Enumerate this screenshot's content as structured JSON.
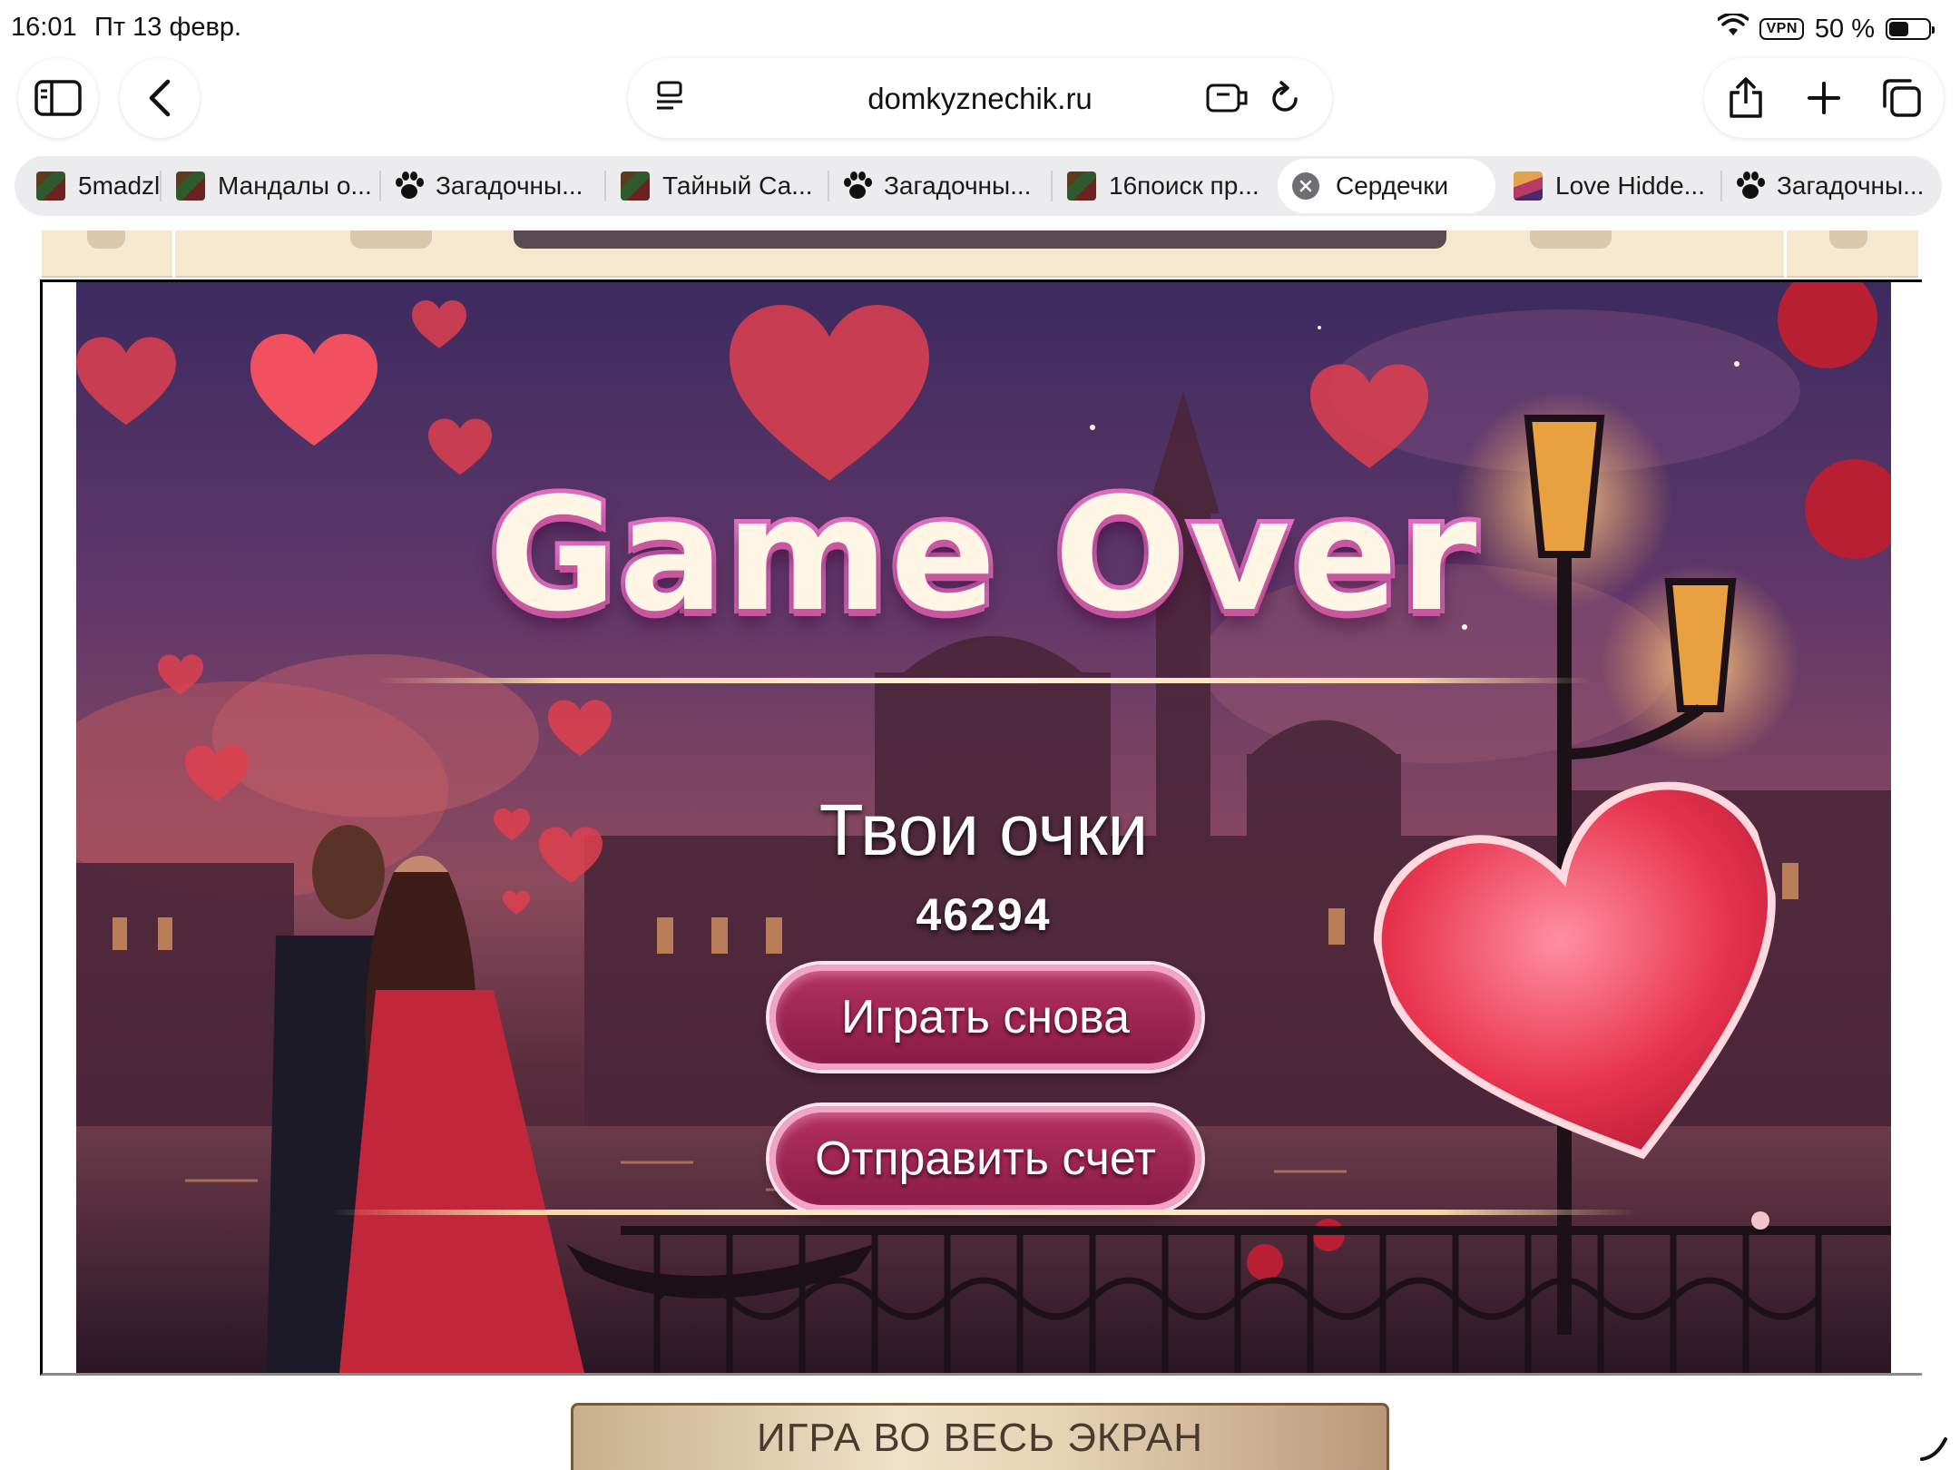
{
  "status_bar": {
    "time": "16:01",
    "date": "Пт 13 февр.",
    "vpn": "VPN",
    "battery": "50 %",
    "battery_level": 0.5
  },
  "browser": {
    "url": "domkyznechik.ru",
    "tabs": [
      {
        "title": "5madzl",
        "favicon": "grid-favicon"
      },
      {
        "title": "Мандалы о...",
        "favicon": "grid-favicon"
      },
      {
        "title": "Загадочны...",
        "favicon": "paw-icon"
      },
      {
        "title": "Тайный Са...",
        "favicon": "grid-favicon"
      },
      {
        "title": "Загадочны...",
        "favicon": "paw-icon"
      },
      {
        "title": "16поиск пр...",
        "favicon": "grid-favicon"
      },
      {
        "title": "Сердечки",
        "favicon": "close-icon",
        "active": true
      },
      {
        "title": "Love Hidde...",
        "favicon": "love-favicon"
      },
      {
        "title": "Загадочны...",
        "favicon": "paw-icon"
      }
    ]
  },
  "game": {
    "title": "Game Over",
    "score_label": "Твои очки",
    "score": "46294",
    "play_again": "Играть снова",
    "submit_score": "Отправить счет"
  },
  "page": {
    "fullscreen": "ИГРА ВО ВЕСЬ ЭКРАН"
  },
  "colors": {
    "title_fill": "#fff6e6",
    "title_stroke": "#e26fc2",
    "button_fill": "#9e2552",
    "button_border": "#f3a3c4",
    "strip": "#f6e9cf"
  }
}
